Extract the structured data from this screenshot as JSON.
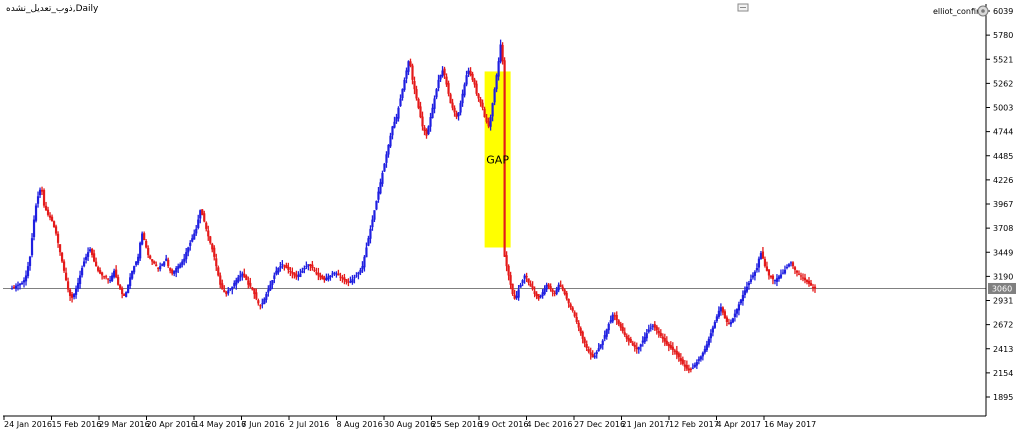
{
  "chart_data": {
    "type": "candlestick",
    "symbol_label": "ذوب_تعدیل_نشده,Daily",
    "indicator_label": "elliot_confirm",
    "current_price": "3060",
    "gap_label": "GAP",
    "y_ticks": [
      "6039",
      "5780",
      "5521",
      "5262",
      "5003",
      "4744",
      "4485",
      "4226",
      "3967",
      "3708",
      "3449",
      "3190",
      "2931",
      "2672",
      "2413",
      "2154",
      "1895"
    ],
    "x_ticks": [
      "24 Jan 2016",
      "15 Feb 2016",
      "29 Mar 2016",
      "20 Apr 2016",
      "14 May 2016",
      "7 Jun 2016",
      "2 Jul 2016",
      "8 Aug 2016",
      "30 Aug 2016",
      "25 Sep 2016",
      "19 Oct 2016",
      "4 Dec 2016",
      "27 Dec 2016",
      "21 Jan 2017",
      "12 Feb 2017",
      "4 Apr 2017",
      "16 May 2017"
    ],
    "ylim": [
      1850,
      6039
    ],
    "gap_zone": {
      "from_price": 3500,
      "to_price": 5390
    },
    "colors": {
      "up": "#1f1fe0",
      "down": "#e41a1a",
      "gap": "#ffff00",
      "grid": "#808080",
      "axis": "#000000",
      "price_box": "#808080"
    },
    "closes": [
      3060,
      3075,
      3090,
      3100,
      3110,
      3120,
      3150,
      3200,
      3300,
      3400,
      3600,
      3800,
      3950,
      4050,
      4120,
      4100,
      3950,
      3900,
      3850,
      3820,
      3780,
      3720,
      3650,
      3550,
      3450,
      3350,
      3250,
      3150,
      3050,
      2980,
      2960,
      3000,
      3060,
      3120,
      3200,
      3280,
      3350,
      3400,
      3450,
      3480,
      3420,
      3350,
      3300,
      3250,
      3220,
      3200,
      3190,
      3180,
      3160,
      3150,
      3200,
      3250,
      3180,
      3100,
      3050,
      3000,
      2980,
      3020,
      3100,
      3180,
      3250,
      3300,
      3350,
      3400,
      3550,
      3650,
      3580,
      3500,
      3420,
      3380,
      3350,
      3330,
      3300,
      3280,
      3300,
      3320,
      3350,
      3380,
      3300,
      3250,
      3220,
      3250,
      3280,
      3300,
      3320,
      3350,
      3380,
      3450,
      3500,
      3550,
      3600,
      3650,
      3700,
      3800,
      3900,
      3850,
      3780,
      3700,
      3620,
      3550,
      3480,
      3400,
      3300,
      3200,
      3100,
      3050,
      3020,
      3000,
      3040,
      3060,
      3080,
      3120,
      3150,
      3180,
      3200,
      3220,
      3180,
      3150,
      3100,
      3080,
      3050,
      3000,
      2950,
      2900,
      2880,
      2900,
      2950,
      3000,
      3050,
      3100,
      3150,
      3200,
      3250,
      3280,
      3300,
      3320,
      3300,
      3280,
      3260,
      3240,
      3220,
      3200,
      3180,
      3200,
      3220,
      3250,
      3280,
      3300,
      3320,
      3300,
      3280,
      3250,
      3220,
      3200,
      3180,
      3160,
      3150,
      3170,
      3190,
      3200,
      3220,
      3230,
      3220,
      3200,
      3180,
      3170,
      3150,
      3130,
      3120,
      3140,
      3160,
      3180,
      3200,
      3230,
      3260,
      3300,
      3400,
      3500,
      3600,
      3700,
      3800,
      3900,
      4000,
      4100,
      4200,
      4300,
      4400,
      4500,
      4600,
      4700,
      4800,
      4850,
      4900,
      5000,
      5100,
      5200,
      5300,
      5400,
      5500,
      5450,
      5300,
      5200,
      5100,
      5000,
      4900,
      4800,
      4750,
      4700,
      4800,
      4900,
      5000,
      5100,
      5200,
      5300,
      5350,
      5400,
      5350,
      5250,
      5150,
      5050,
      5000,
      4950,
      4900,
      4950,
      5050,
      5150,
      5250,
      5350,
      5400,
      5350,
      5300,
      5250,
      5150,
      5100,
      5050,
      5000,
      4900,
      4850,
      4800,
      4900,
      5050,
      5200,
      5350,
      5500,
      5680,
      5500,
      3400,
      3300,
      3200,
      3100,
      3000,
      2950,
      2980,
      3050,
      3100,
      3150,
      3200,
      3180,
      3120,
      3080,
      3050,
      3000,
      2980,
      2950,
      2980,
      3020,
      3060,
      3100,
      3080,
      3050,
      3020,
      3000,
      3050,
      3100,
      3080,
      3050,
      3000,
      2950,
      2900,
      2860,
      2820,
      2760,
      2700,
      2640,
      2580,
      2520,
      2470,
      2420,
      2380,
      2350,
      2320,
      2340,
      2380,
      2420,
      2460,
      2500,
      2560,
      2620,
      2680,
      2720,
      2780,
      2760,
      2720,
      2680,
      2640,
      2600,
      2560,
      2520,
      2500,
      2480,
      2450,
      2430,
      2410,
      2430,
      2460,
      2500,
      2540,
      2580,
      2620,
      2640,
      2660,
      2640,
      2610,
      2580,
      2550,
      2520,
      2490,
      2460,
      2440,
      2420,
      2400,
      2380,
      2350,
      2320,
      2280,
      2250,
      2220,
      2200,
      2180,
      2190,
      2210,
      2240,
      2270,
      2300,
      2330,
      2370,
      2410,
      2460,
      2520,
      2580,
      2640,
      2700,
      2760,
      2820,
      2860,
      2800,
      2740,
      2700,
      2680,
      2700,
      2740,
      2790,
      2840,
      2890,
      2940,
      2990,
      3040,
      3080,
      3120,
      3160,
      3200,
      3240,
      3280,
      3380,
      3440,
      3380,
      3300,
      3250,
      3200,
      3180,
      3160,
      3150,
      3170,
      3190,
      3210,
      3230,
      3260,
      3290,
      3320,
      3340,
      3300,
      3260,
      3230,
      3210,
      3190,
      3170,
      3150,
      3130,
      3110,
      3090,
      3070,
      3060
    ]
  }
}
